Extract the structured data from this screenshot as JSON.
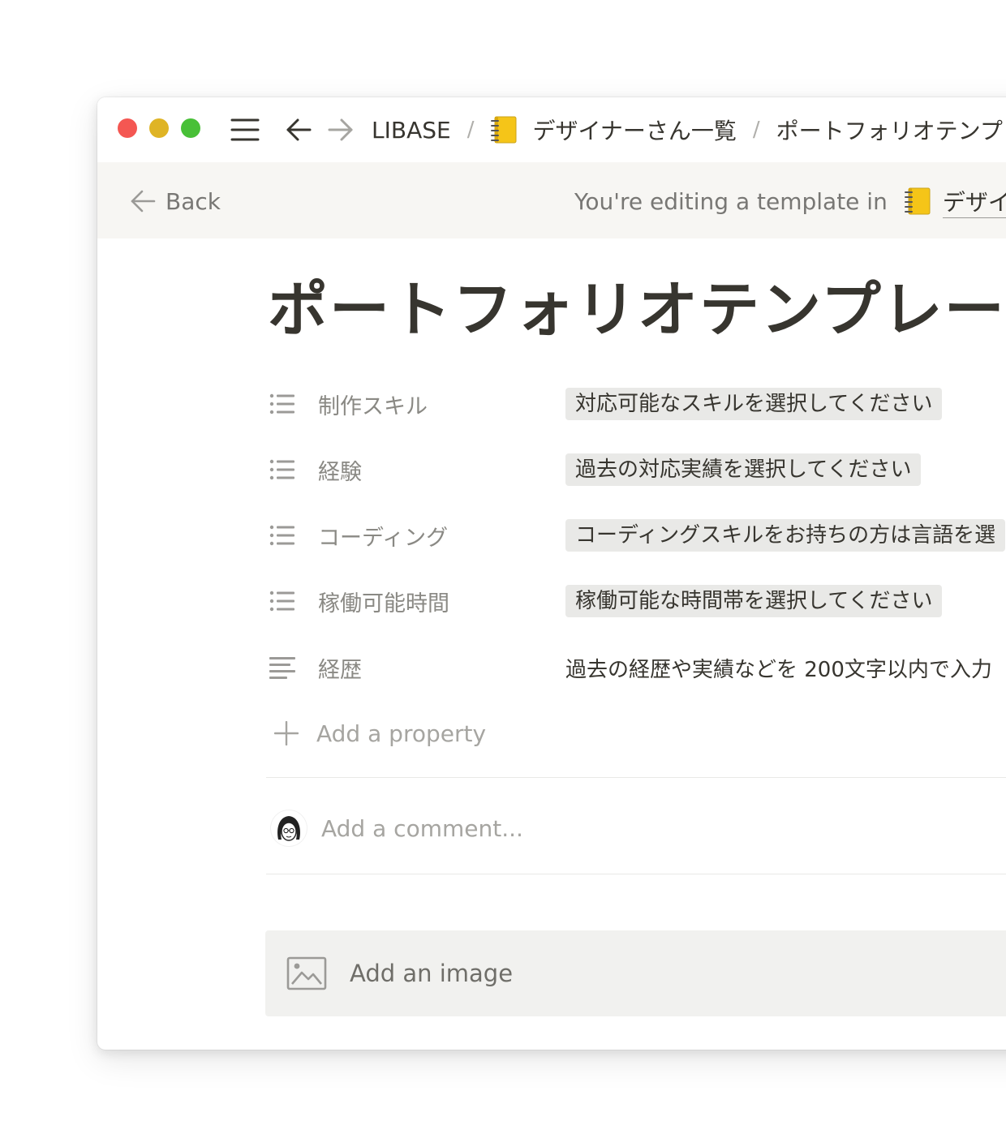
{
  "titlebar": {
    "breadcrumbs": [
      {
        "label": "LIBASE",
        "icon": ""
      },
      {
        "label": "デザイナーさん一覧",
        "icon": "notebook-icon"
      },
      {
        "label": "ポートフォリオテンプレ",
        "icon": ""
      }
    ],
    "separator": "/"
  },
  "banner": {
    "back_label": "Back",
    "editing_text": "You're editing a template in",
    "target_label": "デザイナ"
  },
  "page": {
    "title": "ポートフォリオテンプレート"
  },
  "properties": [
    {
      "name": "制作スキル",
      "icon": "list-icon",
      "value": "対応可能なスキルを選択してください",
      "style": "tag"
    },
    {
      "name": "経験",
      "icon": "list-icon",
      "value": "過去の対応実績を選択してください",
      "style": "tag"
    },
    {
      "name": "コーディング",
      "icon": "list-icon",
      "value": "コーディングスキルをお持ちの方は言語を選",
      "style": "tag"
    },
    {
      "name": "稼働可能時間",
      "icon": "list-icon",
      "value": "稼働可能な時間帯を選択してください",
      "style": "tag"
    },
    {
      "name": "経歴",
      "icon": "text-lines-icon",
      "value": "過去の経歴や実績などを 200文字以内で入力",
      "style": "plain"
    }
  ],
  "add_property_label": "Add a property",
  "comment": {
    "placeholder": "Add a comment..."
  },
  "add_image_label": "Add an image",
  "colors": {
    "close": "#f45752",
    "minimize": "#dfb425",
    "zoom": "#48c037",
    "notebook": "#f5c518",
    "banner_bg": "#f7f6f3",
    "tag_bg": "#e9e9e7"
  }
}
